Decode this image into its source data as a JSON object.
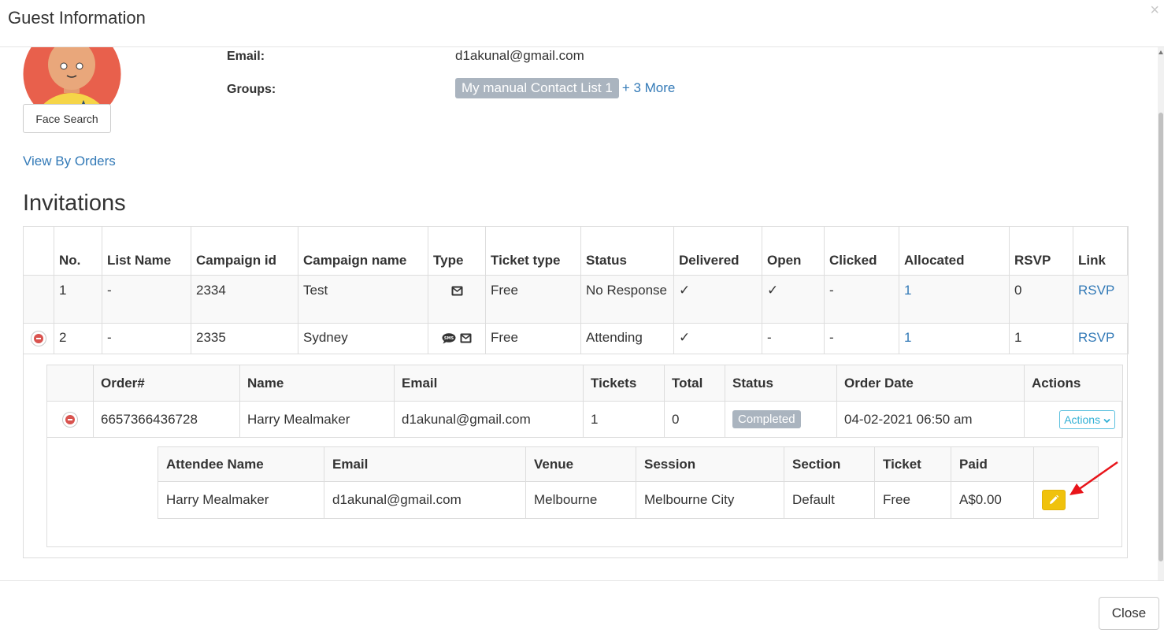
{
  "modal": {
    "title": "Guest Information",
    "close_x": "×",
    "close_button": "Close"
  },
  "guest": {
    "face_search": "Face Search",
    "email_label": "Email:",
    "email_value": "d1akunal@gmail.com",
    "groups_label": "Groups:",
    "group_badge": "My manual Contact List 1",
    "more_groups": "+ 3 More",
    "view_by_orders": "View By Orders"
  },
  "invitations": {
    "title": "Invitations",
    "headers": [
      "No.",
      "List Name",
      "Campaign id",
      "Campaign name",
      "Type",
      "Ticket type",
      "Status",
      "Delivered",
      "Open",
      "Clicked",
      "Allocated",
      "RSVP",
      "Link"
    ],
    "rows": [
      {
        "no": "1",
        "list_name": "-",
        "campaign_id": "2334",
        "campaign_name": "Test",
        "type": [
          "email-icon"
        ],
        "ticket_type": "Free",
        "status": "No Response",
        "delivered": "✓",
        "open": "✓",
        "clicked": "-",
        "allocated": "1",
        "rsvp": "0",
        "link": "RSVP"
      },
      {
        "no": "2",
        "list_name": "-",
        "campaign_id": "2335",
        "campaign_name": "Sydney",
        "type": [
          "sms-icon",
          "email-icon"
        ],
        "ticket_type": "Free",
        "status": "Attending",
        "delivered": "✓",
        "open": "-",
        "clicked": "-",
        "allocated": "1",
        "rsvp": "1",
        "link": "RSVP"
      }
    ]
  },
  "orders": {
    "headers": [
      "Order#",
      "Name",
      "Email",
      "Tickets",
      "Total",
      "Status",
      "Order Date",
      "Actions"
    ],
    "rows": [
      {
        "order_no": "6657366436728",
        "name": "Harry Mealmaker",
        "email": "d1akunal@gmail.com",
        "tickets": "1",
        "total": "0",
        "status": "Completed",
        "order_date": "04-02-2021 06:50 am",
        "actions": "Actions"
      }
    ]
  },
  "attendees": {
    "headers": [
      "Attendee Name",
      "Email",
      "Venue",
      "Session",
      "Section",
      "Ticket",
      "Paid",
      ""
    ],
    "rows": [
      {
        "name": "Harry Mealmaker",
        "email": "d1akunal@gmail.com",
        "venue": "Melbourne",
        "session": "Melbourne City",
        "section": "Default",
        "ticket": "Free",
        "paid": "A$0.00"
      }
    ]
  },
  "colors": {
    "link": "#337ab7",
    "badge_gray": "#aab4bf",
    "remove_red": "#d9534f",
    "edit_yellow": "#f0c20c",
    "actions_teal": "#5bc0de",
    "annotation_arrow": "#e8141a"
  }
}
